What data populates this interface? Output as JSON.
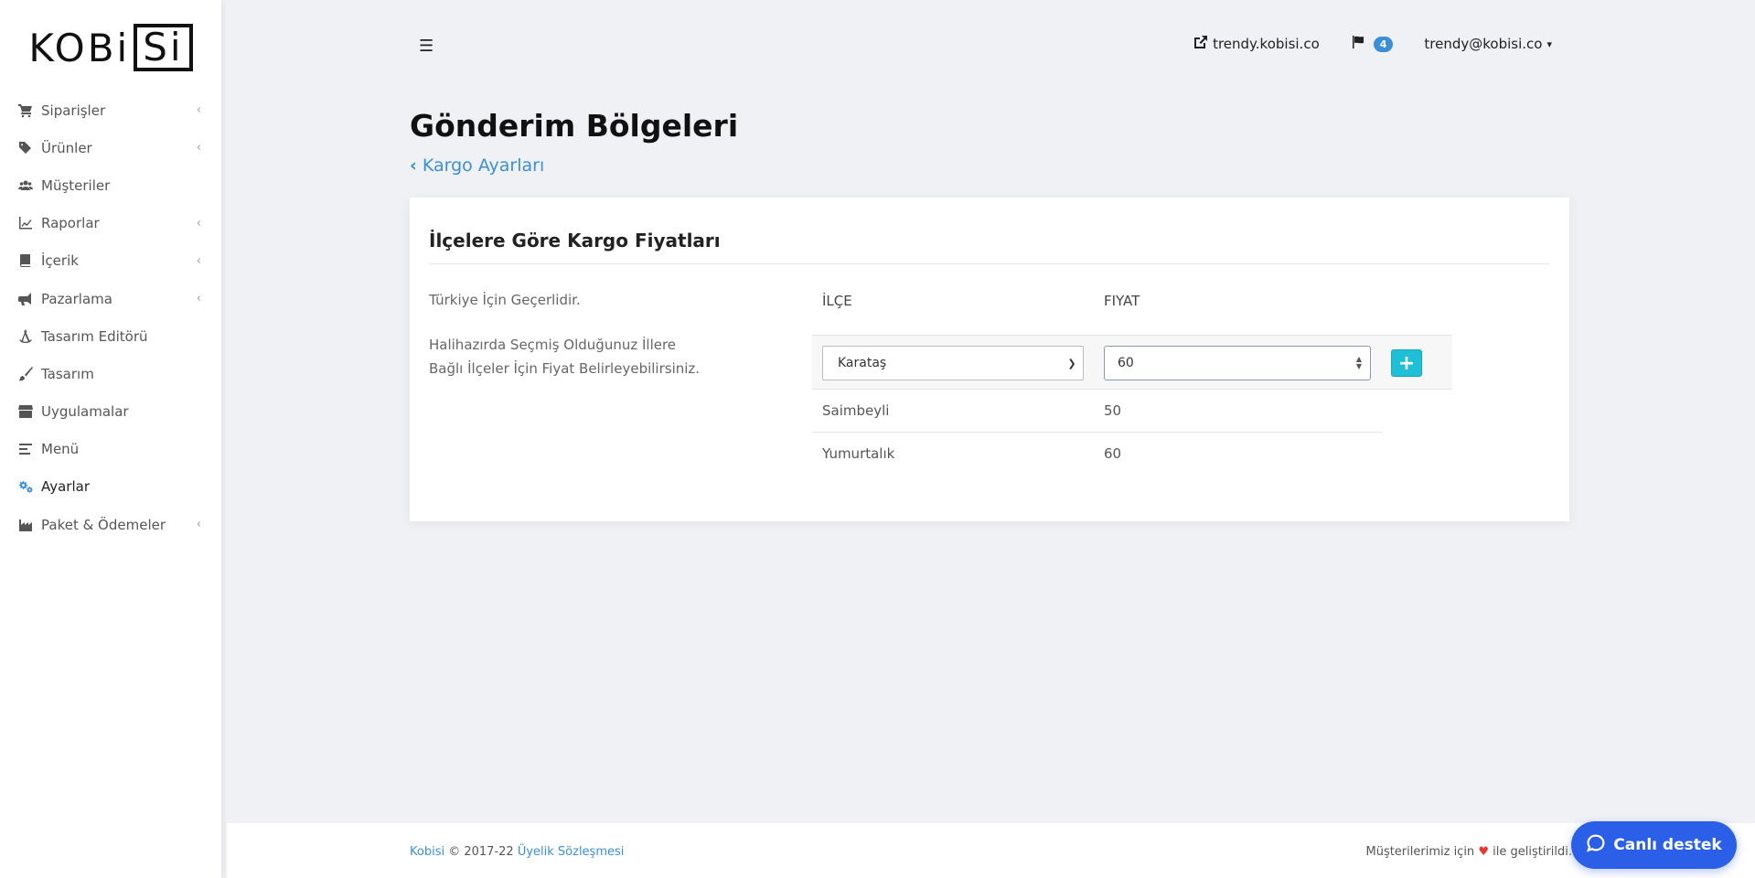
{
  "brand": {
    "logo_left": "KOBi",
    "logo_box": "Si"
  },
  "sidebar": {
    "items": [
      {
        "label": "Siparişler",
        "icon": "cart-icon",
        "has_children": true
      },
      {
        "label": "Ürünler",
        "icon": "tags-icon",
        "has_children": true
      },
      {
        "label": "Müşteriler",
        "icon": "users-icon",
        "has_children": false
      },
      {
        "label": "Raporlar",
        "icon": "chart-line-icon",
        "has_children": true
      },
      {
        "label": "İçerik",
        "icon": "book-icon",
        "has_children": true
      },
      {
        "label": "Pazarlama",
        "icon": "megaphone-icon",
        "has_children": true
      },
      {
        "label": "Tasarım Editörü",
        "icon": "drafting-compass-icon",
        "has_children": false
      },
      {
        "label": "Tasarım",
        "icon": "brush-icon",
        "has_children": false
      },
      {
        "label": "Uygulamalar",
        "icon": "store-icon",
        "has_children": false
      },
      {
        "label": "Menü",
        "icon": "align-left-icon",
        "has_children": false
      },
      {
        "label": "Ayarlar",
        "icon": "cogs-icon",
        "has_children": false,
        "active": true
      },
      {
        "label": "Paket & Ödemeler",
        "icon": "industry-icon",
        "has_children": true
      }
    ]
  },
  "topbar": {
    "store_link": "trendy.kobisi.co",
    "notifications_count": "4",
    "user_email": "trendy@kobisi.co"
  },
  "page": {
    "title": "Gönderim Bölgeleri",
    "back_label": "Kargo Ayarları"
  },
  "card": {
    "title": "İlçelere Göre Kargo Fiyatları",
    "desc1": "Türkiye İçin Geçerlidir.",
    "desc2": "Halihazırda Seçmiş Olduğunuz İllere Bağlı İlçeler İçin Fiyat Belirleyebilirsiniz.",
    "columns": [
      "İLÇE",
      "FIYAT"
    ],
    "edit_row": {
      "district": "Karataş",
      "price": "60",
      "add_label": "+"
    },
    "rows": [
      {
        "district": "Saimbeyli",
        "price": "50"
      },
      {
        "district": "Yumurtalık",
        "price": "60"
      }
    ]
  },
  "footer": {
    "brand_link": "Kobisi",
    "copyright": "© 2017-22",
    "terms_link": "Üyelik Sözleşmesi",
    "right_pre": "Müşterilerimiz için",
    "right_post": "ile geliştirildi."
  },
  "chat": {
    "label": "Canlı destek"
  },
  "colors": {
    "accent": "#3b8fd8",
    "chat": "#2b5fe8",
    "add_button": "#1fbfd8"
  }
}
